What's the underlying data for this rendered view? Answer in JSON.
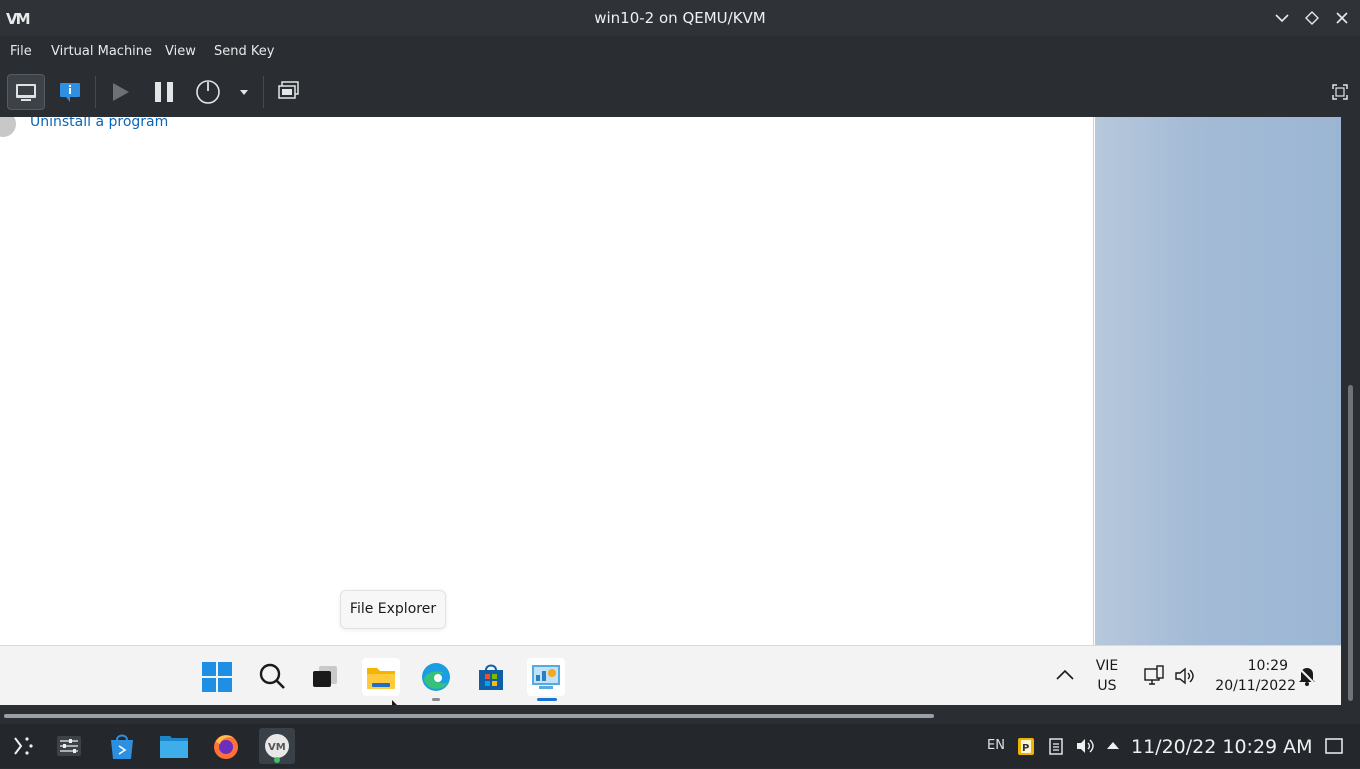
{
  "window": {
    "title": "win10-2 on QEMU/KVM",
    "app_logo": "VM"
  },
  "menu": [
    "File",
    "Virtual Machine",
    "View",
    "Send Key"
  ],
  "toolbar": {
    "buttons": [
      "console-view",
      "details-view",
      "run",
      "pause",
      "shutdown",
      "shutdown-menu",
      "snapshots",
      "fullscreen"
    ]
  },
  "guest": {
    "link_text": "Uninstall a program",
    "tooltip": "File Explorer",
    "taskbar": {
      "apps": [
        "start",
        "search",
        "task-view",
        "file-explorer",
        "edge",
        "store",
        "control-panel"
      ],
      "lang_line1": "VIE",
      "lang_line2": "US",
      "time": "10:29",
      "date": "20/11/2022"
    }
  },
  "panel": {
    "lang": "EN",
    "clock": "11/20/22 10:29 AM"
  }
}
